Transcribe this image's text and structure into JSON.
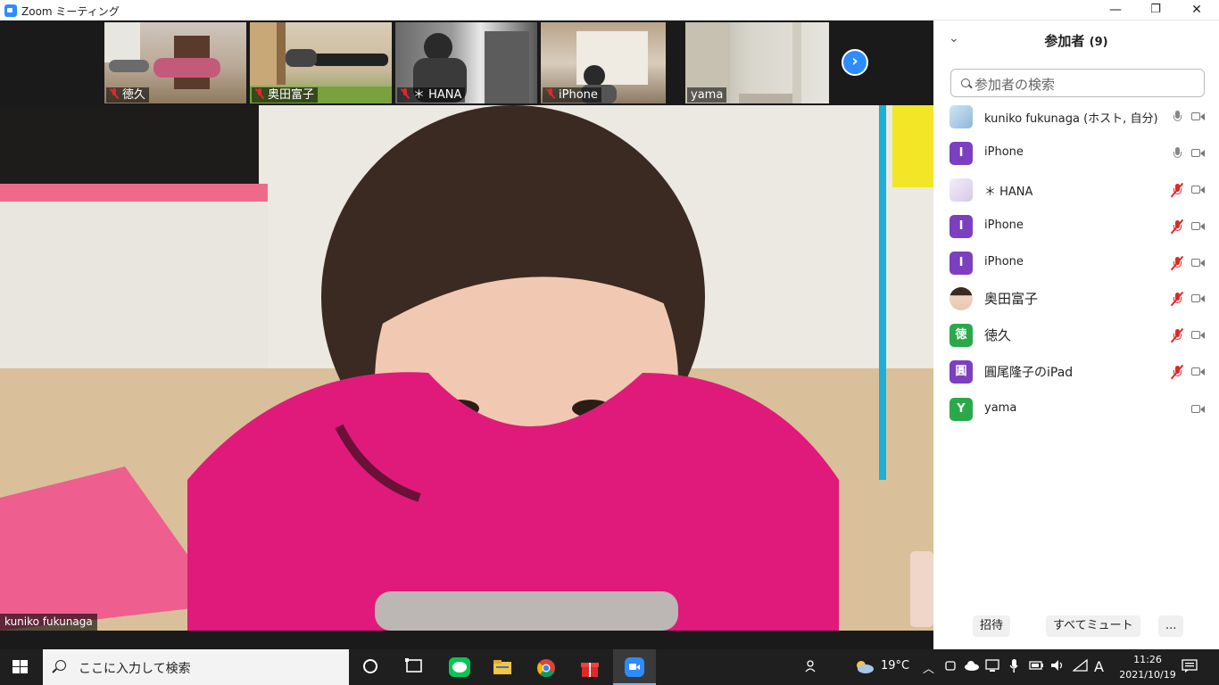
{
  "window": {
    "title": "Zoom ミーティング",
    "minimize": "—",
    "maximize": "❐",
    "close": "✕"
  },
  "gallery": [
    {
      "name": "徳久",
      "muted": true
    },
    {
      "name": "奥田富子",
      "muted": true
    },
    {
      "name": "＊ HANA",
      "muted": true
    },
    {
      "name": "iPhone",
      "muted": true
    },
    {
      "name": "yama",
      "muted": false
    }
  ],
  "gallery_next": "›",
  "main_speaker": "kuniko fukunaga",
  "panel": {
    "collapse": "⌄",
    "title": "参加者",
    "count": "(9)",
    "search_placeholder": "参加者の検索",
    "participants": [
      {
        "name": "kuniko fukunaga (ホスト, 自分)",
        "avatar": "",
        "avatar_color": "#9fc7e8",
        "mic": "on",
        "cam": true
      },
      {
        "name": "iPhone",
        "avatar": "I",
        "avatar_color": "#7b3fbf",
        "mic": "on",
        "cam": true
      },
      {
        "name": "＊ HANA",
        "avatar": "",
        "avatar_color": "#e8e0f0",
        "mic": "off",
        "cam": true
      },
      {
        "name": "iPhone",
        "avatar": "I",
        "avatar_color": "#7b3fbf",
        "mic": "off",
        "cam": true
      },
      {
        "name": "iPhone",
        "avatar": "I",
        "avatar_color": "#7b3fbf",
        "mic": "off",
        "cam": true
      },
      {
        "name": "奥田富子",
        "avatar": "",
        "avatar_color": "#d8c2a8",
        "mic": "off",
        "cam": true
      },
      {
        "name": "徳久",
        "avatar": "徳",
        "avatar_color": "#2aa84a",
        "mic": "off",
        "cam": true
      },
      {
        "name": "圓尾隆子のiPad",
        "avatar": "圓",
        "avatar_color": "#7b3fbf",
        "mic": "off",
        "cam": true
      },
      {
        "name": "yama",
        "avatar": "Y",
        "avatar_color": "#2aa84a",
        "mic": "none",
        "cam": true
      }
    ],
    "buttons": {
      "invite": "招待",
      "mute_all": "すべてミュート",
      "more": "..."
    }
  },
  "taskbar": {
    "search_placeholder": "ここに入力して検索",
    "weather": "19°C",
    "ime": "A",
    "time": "11:26",
    "date": "2021/10/19"
  },
  "colors": {
    "zoom_blue": "#2d8cff",
    "muted_red": "#e02828",
    "taskbar": "#1f1f1f"
  }
}
